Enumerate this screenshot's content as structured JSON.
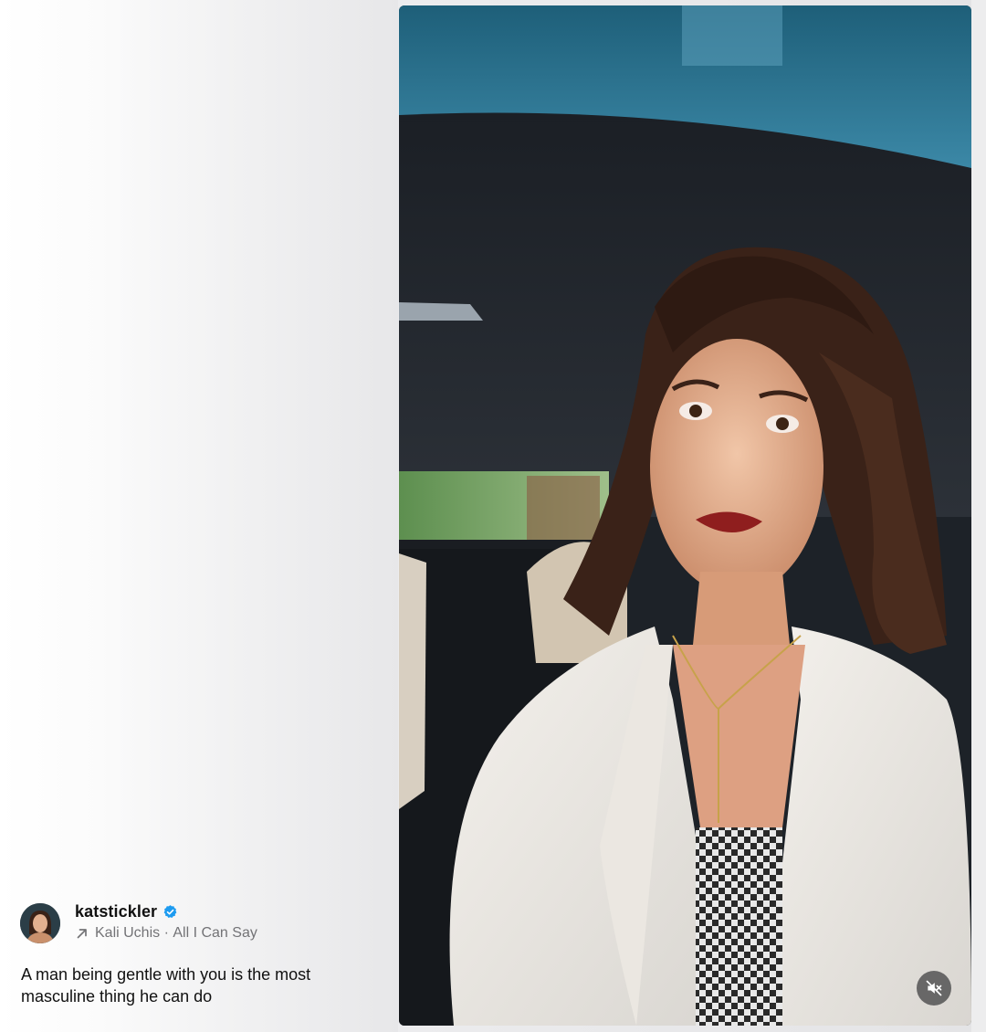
{
  "post": {
    "username": "katstickler",
    "verified": true,
    "audio": {
      "artist": "Kali Uchis",
      "separator": " · ",
      "title": "All I Can Say"
    },
    "caption": "A man being gentle with you is the most masculine thing he can do"
  },
  "video": {
    "muted": true,
    "description": "Woman in a white shirt talking to camera inside a car"
  },
  "colors": {
    "verified_badge": "#1d9bf0",
    "secondary_text": "#737376",
    "primary_text": "#111111"
  },
  "icons": {
    "mute": "speaker-muted-icon",
    "verified": "verified-badge-icon",
    "audio": "arrow-up-right-icon"
  }
}
